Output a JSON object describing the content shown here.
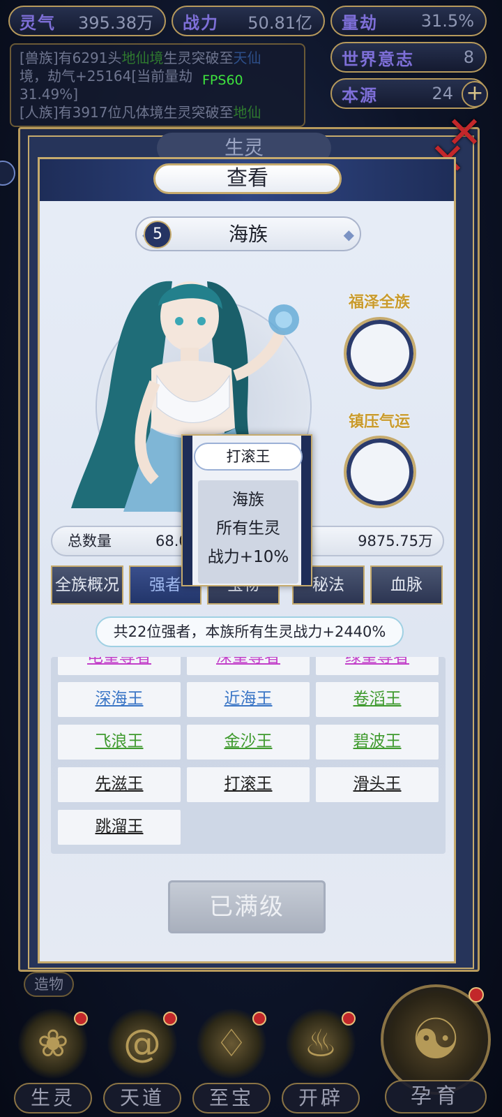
{
  "resources": [
    {
      "label": "灵气",
      "value": "395.38万"
    },
    {
      "label": "战力",
      "value": "50.81亿"
    },
    {
      "label": "量劫",
      "value": "31.5%"
    },
    {
      "label": "世界意志",
      "value": "8"
    },
    {
      "label": "本源",
      "value": "24"
    }
  ],
  "fps": "FPS60",
  "log": {
    "line1_a": "[兽族]有6291头",
    "line1_b": "地仙境",
    "line1_c": "生灵突破至",
    "line1_d": "天仙",
    "line2": "境，劫气+25164[当前量劫",
    "line3": "31.49%]",
    "line4_a": "[人族]有3917位凡体境生灵突破至",
    "line4_b": "地仙"
  },
  "back_title": "生灵",
  "panel": {
    "title": "查看",
    "race_number": "5",
    "race_name": "海族",
    "slot1_label": "福泽全族",
    "slot2_label": "镇压气运",
    "stats": {
      "label": "总数量",
      "count": "68.0",
      "power": "9875.75万"
    },
    "tabs": [
      "全族概况",
      "强者",
      "宝物",
      "秘法",
      "血脉"
    ],
    "summary": "共22位强者，本族所有生灵战力+2440%",
    "champions_partial": [
      "电皇尊者",
      "深皇尊者",
      "绿皇尊者"
    ],
    "champions": [
      {
        "name": "深海王",
        "color": "blue"
      },
      {
        "name": "近海王",
        "color": "blue"
      },
      {
        "name": "卷滔王",
        "color": "green"
      },
      {
        "name": "飞浪王",
        "color": "green"
      },
      {
        "name": "金沙王",
        "color": "green"
      },
      {
        "name": "碧波王",
        "color": "green"
      },
      {
        "name": "先滋王",
        "color": "black"
      },
      {
        "name": "打滚王",
        "color": "black"
      },
      {
        "name": "滑头王",
        "color": "black"
      },
      {
        "name": "跳溜王",
        "color": "black"
      }
    ],
    "max_button": "已满级"
  },
  "popup": {
    "title": "打滚王",
    "line1": "海族",
    "line2": "所有生灵",
    "line3": "战力+10%"
  },
  "side_tag": "造物",
  "nav": [
    {
      "label": "生灵",
      "icon": "lotus-icon"
    },
    {
      "label": "天道",
      "icon": "swirl-icon"
    },
    {
      "label": "至宝",
      "icon": "treasure-icon"
    },
    {
      "label": "开辟",
      "icon": "flame-icon"
    },
    {
      "label": "孕育",
      "icon": "embryo-icon"
    }
  ]
}
